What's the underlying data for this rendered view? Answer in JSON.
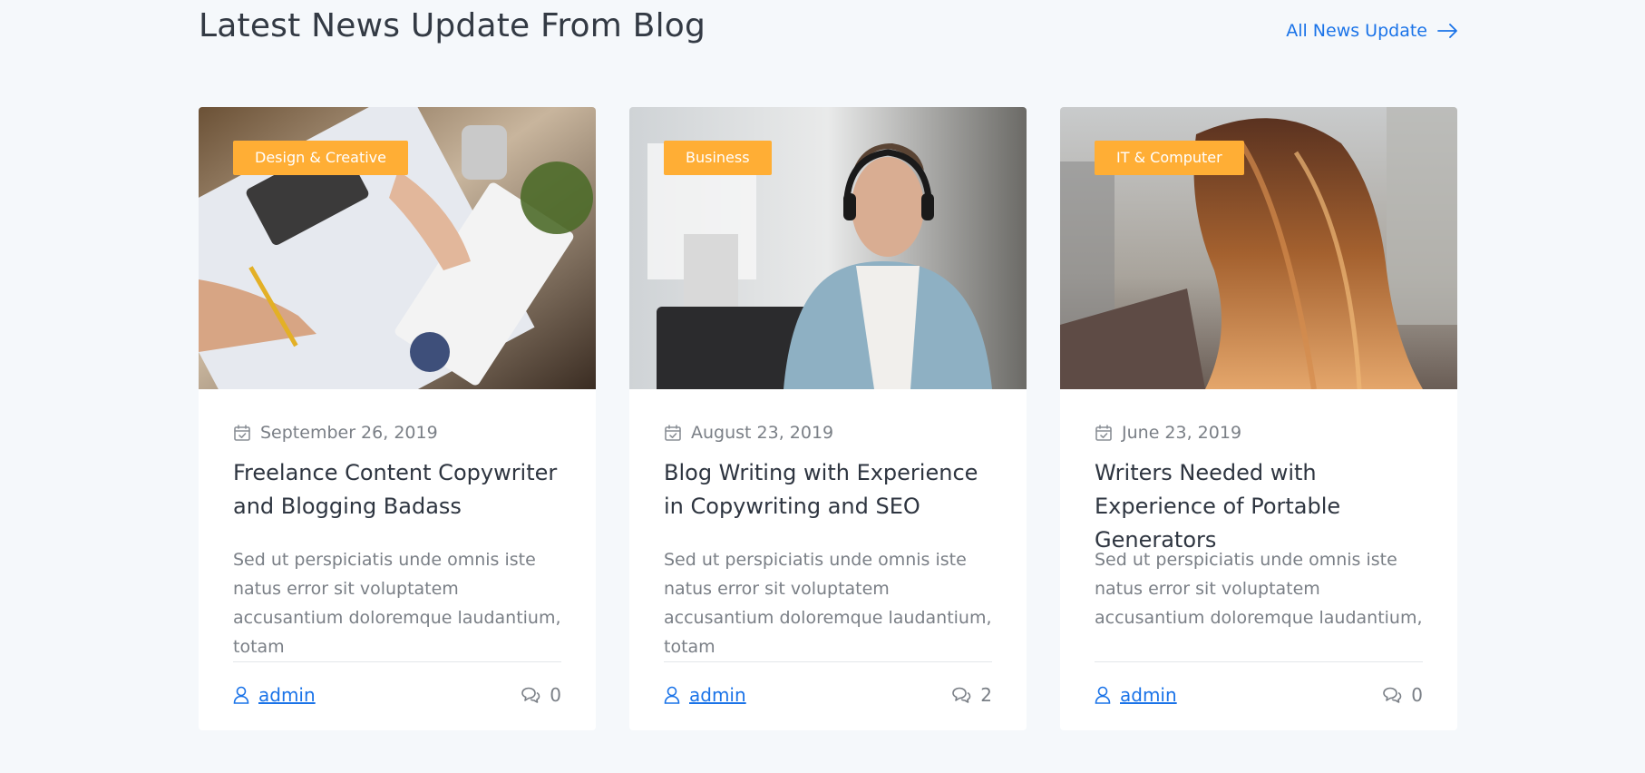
{
  "section": {
    "title": "Latest News Update From Blog",
    "all_link_label": "All News Update"
  },
  "colors": {
    "accent": "#1a73e8",
    "badge": "#ffae35",
    "background": "#f5f8fb"
  },
  "posts": [
    {
      "category": "Design & Creative",
      "image": "desk-with-calculator-keyboard-and-charts",
      "date": "September 26, 2019",
      "title": "Freelance Content Copywriter and Blogging Badass",
      "excerpt": "Sed ut perspiciatis unde omnis iste natus error sit voluptatem accusantium doloremque laudantium, totam",
      "author": "admin",
      "comments": "0"
    },
    {
      "category": "Business",
      "image": "man-with-headphones-at-laptop",
      "date": "August 23, 2019",
      "title": "Blog Writing with Experience in Copywriting and SEO",
      "excerpt": "Sed ut perspiciatis unde omnis iste natus error sit voluptatem accusantium doloremque laudantium, totam",
      "author": "admin",
      "comments": "2"
    },
    {
      "category": "IT & Computer",
      "image": "woman-with-long-wavy-hair-from-behind",
      "date": "June 23, 2019",
      "title": "Writers Needed with Experience of Portable Generators",
      "excerpt": "Sed ut perspiciatis unde omnis iste natus error sit voluptatem accusantium doloremque laudantium,",
      "author": "admin",
      "comments": "0"
    }
  ]
}
